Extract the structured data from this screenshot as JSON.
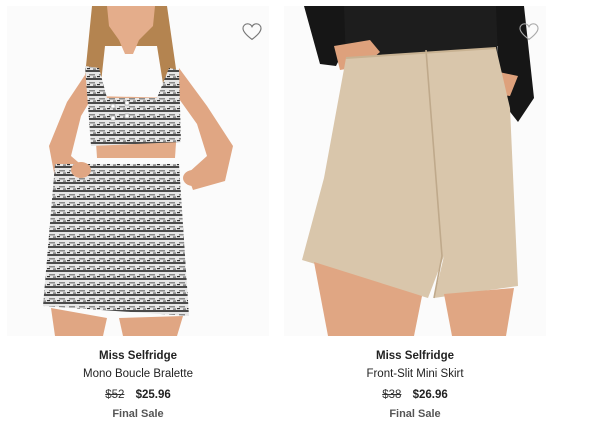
{
  "products": [
    {
      "brand": "Miss Selfridge",
      "name": "Mono Boucle Bralette",
      "original_price": "$52",
      "sale_price": "$25.96",
      "badge": "Final Sale",
      "wishlist_icon": "heart-outline-icon",
      "image": "model wearing black and white boucle bralette and mini skirt"
    },
    {
      "brand": "Miss Selfridge",
      "name": "Front-Slit Mini Skirt",
      "original_price": "$38",
      "sale_price": "$26.96",
      "badge": "Final Sale",
      "wishlist_icon": "heart-outline-icon",
      "image": "model wearing beige front-slit mini skirt with black top"
    }
  ],
  "colors": {
    "text": "#222222",
    "badge": "#555555",
    "skirt_beige": "#d9c6ab",
    "skin": "#e2a886"
  }
}
